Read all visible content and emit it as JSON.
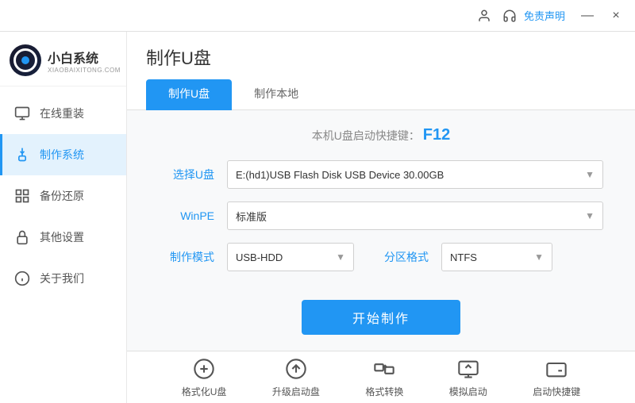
{
  "titleBar": {
    "freeLabel": "免责声明",
    "minimizeLabel": "—",
    "closeLabel": "×"
  },
  "logo": {
    "name": "小白系统",
    "sub": "XIAOBAIXITONG.COM"
  },
  "sidebar": {
    "items": [
      {
        "id": "online-reinstall",
        "label": "在线重装",
        "icon": "monitor"
      },
      {
        "id": "make-system",
        "label": "制作系统",
        "icon": "usb",
        "active": true
      },
      {
        "id": "backup-restore",
        "label": "备份还原",
        "icon": "grid"
      },
      {
        "id": "other-settings",
        "label": "其他设置",
        "icon": "lock"
      },
      {
        "id": "about-us",
        "label": "关于我们",
        "icon": "info"
      }
    ]
  },
  "pageTitle": "制作U盘",
  "tabs": [
    {
      "id": "make-udisk",
      "label": "制作U盘",
      "active": true
    },
    {
      "id": "make-local",
      "label": "制作本地",
      "active": false
    }
  ],
  "shortcut": {
    "prefix": "本机U盘启动快捷键：",
    "key": "F12"
  },
  "form": {
    "fields": [
      {
        "id": "select-udisk",
        "label": "选择U盘",
        "value": "E:(hd1)USB Flash Disk USB Device 30.00GB",
        "type": "select"
      },
      {
        "id": "winpe",
        "label": "WinPE",
        "value": "标准版",
        "type": "select"
      }
    ],
    "modeLabel": "制作模式",
    "modeValue": "USB-HDD",
    "partLabel": "分区格式",
    "partValue": "NTFS",
    "startButton": "开始制作"
  },
  "bottomTools": [
    {
      "id": "format-udisk",
      "label": "格式化U盘",
      "icon": "format"
    },
    {
      "id": "upgrade-boot",
      "label": "升级启动盘",
      "icon": "upload"
    },
    {
      "id": "format-convert",
      "label": "格式转换",
      "icon": "convert"
    },
    {
      "id": "simulate-boot",
      "label": "模拟启动",
      "icon": "screen"
    },
    {
      "id": "boot-shortcut",
      "label": "启动快捷键",
      "icon": "keyboard"
    }
  ]
}
